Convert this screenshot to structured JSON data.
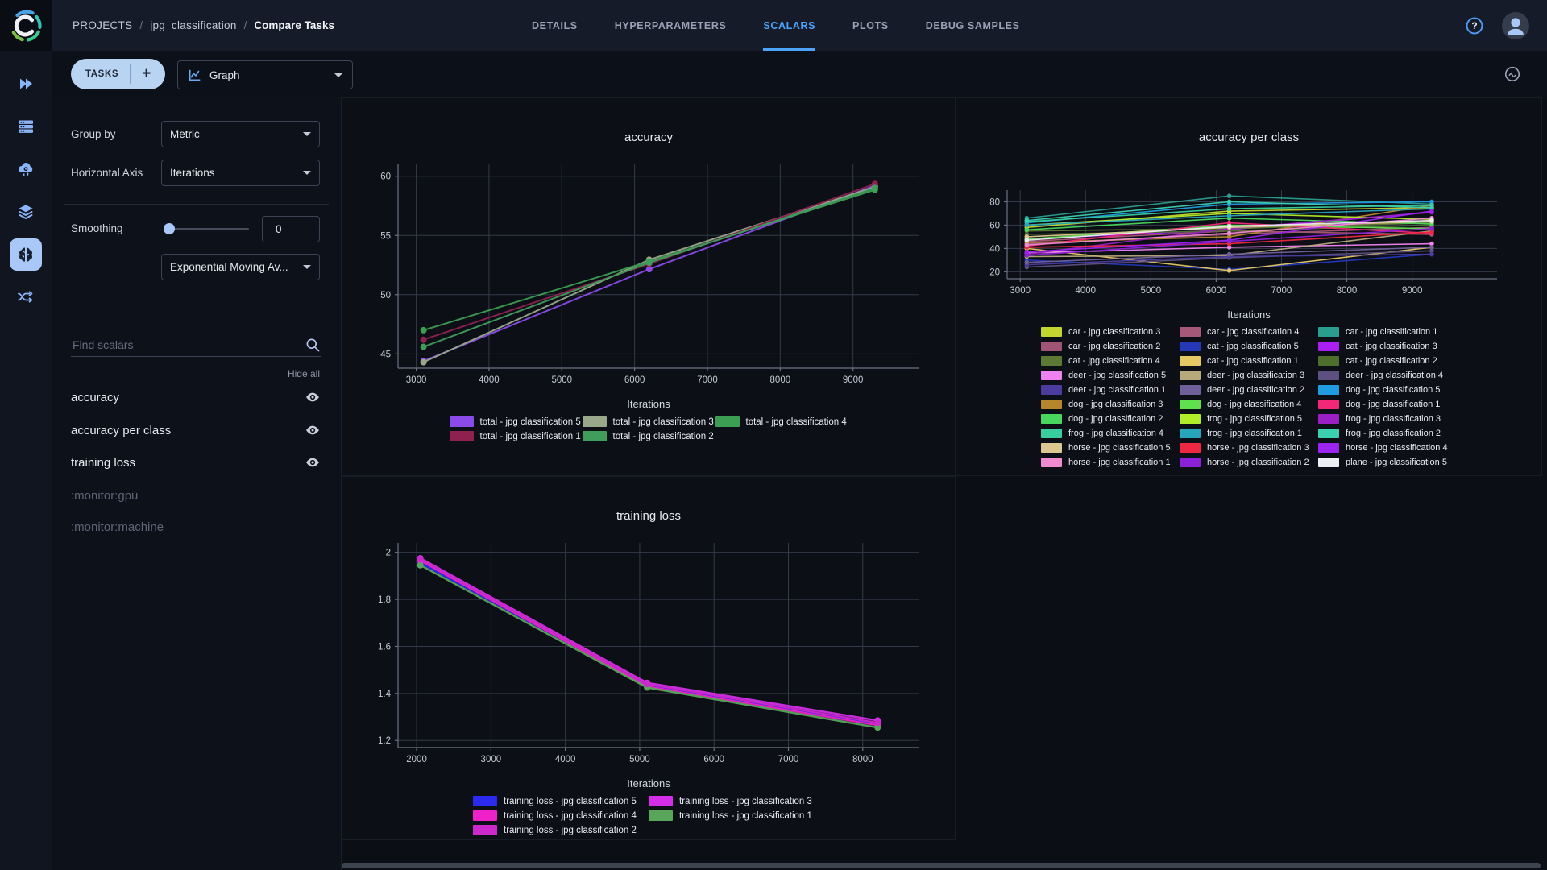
{
  "header": {
    "breadcrumb": {
      "root": "PROJECTS",
      "sep": "/",
      "project": "jpg_classification",
      "page": "Compare Tasks"
    },
    "tabs": [
      {
        "label": "DETAILS",
        "active": false
      },
      {
        "label": "HYPERPARAMETERS",
        "active": false
      },
      {
        "label": "SCALARS",
        "active": true
      },
      {
        "label": "PLOTS",
        "active": false
      },
      {
        "label": "DEBUG SAMPLES",
        "active": false
      }
    ]
  },
  "toolbar": {
    "tasks_button": "TASKS",
    "add_button": "+",
    "view_mode": "Graph"
  },
  "controls": {
    "group_by_label": "Group by",
    "group_by_value": "Metric",
    "horizontal_axis_label": "Horizontal Axis",
    "horizontal_axis_value": "Iterations",
    "smoothing_label": "Smoothing",
    "smoothing_value": "0",
    "smoothing_algorithm": "Exponential Moving Av...",
    "find_scalars_placeholder": "Find scalars",
    "hide_all_label": "Hide all",
    "metrics": [
      {
        "label": "accuracy",
        "visible": true
      },
      {
        "label": "accuracy per class",
        "visible": true
      },
      {
        "label": "training loss",
        "visible": true
      },
      {
        "label": ":monitor:gpu",
        "visible": false
      },
      {
        "label": ":monitor:machine",
        "visible": false
      }
    ]
  },
  "accent_colors": {
    "tab_active": "#4da3f8",
    "button_fill": "#b9d3f3",
    "nav_icon": "#8ab4f8"
  },
  "chart_data": [
    {
      "type": "line",
      "title": "accuracy",
      "xlabel": "Iterations",
      "x": [
        3100,
        6200,
        9300
      ],
      "xticks": [
        3000,
        4000,
        5000,
        6000,
        7000,
        8000,
        9000
      ],
      "yticks": [
        45,
        50,
        55,
        60
      ],
      "xlim": [
        2750,
        9900
      ],
      "ylim": [
        43.8,
        61
      ],
      "grid": true,
      "legend_position": "bottom",
      "series": [
        {
          "name": "total - jpg classification 5",
          "color": "#8a4be8",
          "values": [
            44.4,
            52.15,
            59.2
          ]
        },
        {
          "name": "total - jpg classification 3",
          "color": "#99a889",
          "values": [
            44.3,
            52.95,
            59.1
          ]
        },
        {
          "name": "total - jpg classification 4",
          "color": "#3c9e52",
          "values": [
            47.0,
            52.8,
            58.85
          ]
        },
        {
          "name": "total - jpg classification 1",
          "color": "#8e2150",
          "values": [
            46.2,
            52.6,
            59.35
          ]
        },
        {
          "name": "total - jpg classification 2",
          "color": "#3f9e5c",
          "values": [
            45.6,
            52.7,
            59.0
          ]
        }
      ]
    },
    {
      "type": "line",
      "title": "accuracy per class",
      "xlabel": "Iterations",
      "x": [
        3100,
        6200,
        9300
      ],
      "xticks": [
        3000,
        4000,
        5000,
        6000,
        7000,
        8000,
        9000
      ],
      "yticks": [
        20,
        40,
        60,
        80
      ],
      "xlim": [
        2800,
        10300
      ],
      "ylim": [
        14,
        90
      ],
      "grid": true,
      "legend_position": "bottom",
      "series": [
        {
          "name": "car - jpg classification 3",
          "color": "#c3d62e",
          "values": [
            58,
            72,
            75
          ]
        },
        {
          "name": "car - jpg classification 4",
          "color": "#a65878",
          "values": [
            46,
            55,
            52
          ]
        },
        {
          "name": "car - jpg classification 1",
          "color": "#2a9d8f",
          "values": [
            66,
            85,
            78
          ]
        },
        {
          "name": "car - jpg classification 2",
          "color": "#a05577",
          "values": [
            44,
            52,
            58
          ]
        },
        {
          "name": "cat - jpg classification 5",
          "color": "#2438b8",
          "values": [
            30,
            22,
            35
          ]
        },
        {
          "name": "cat - jpg classification 3",
          "color": "#aa1ff2",
          "values": [
            48,
            56,
            71
          ]
        },
        {
          "name": "cat - jpg classification 4",
          "color": "#5c7a33",
          "values": [
            55,
            57,
            62
          ]
        },
        {
          "name": "cat - jpg classification 1",
          "color": "#e5c763",
          "values": [
            40,
            21,
            41
          ]
        },
        {
          "name": "cat - jpg classification 2",
          "color": "#4d6e2d",
          "values": [
            52,
            55,
            60
          ]
        },
        {
          "name": "deer - jpg classification 5",
          "color": "#ee82ee",
          "values": [
            36,
            41,
            44
          ]
        },
        {
          "name": "deer - jpg classification 3",
          "color": "#b7a97b",
          "values": [
            33,
            34,
            55
          ]
        },
        {
          "name": "deer - jpg classification 4",
          "color": "#5e5080",
          "values": [
            24,
            32,
            38
          ]
        },
        {
          "name": "deer - jpg classification 1",
          "color": "#4b3c9e",
          "values": [
            26,
            33,
            35
          ]
        },
        {
          "name": "deer - jpg classification 2",
          "color": "#70609a",
          "values": [
            28,
            35,
            41
          ]
        },
        {
          "name": "dog - jpg classification 5",
          "color": "#1f9de0",
          "values": [
            62,
            78,
            80
          ]
        },
        {
          "name": "dog - jpg classification 3",
          "color": "#b5862b",
          "values": [
            45,
            50,
            77
          ]
        },
        {
          "name": "dog - jpg classification 4",
          "color": "#5fe04d",
          "values": [
            48,
            60,
            57
          ]
        },
        {
          "name": "dog - jpg classification 1",
          "color": "#f22778",
          "values": [
            42,
            62,
            53
          ]
        },
        {
          "name": "dog - jpg classification 2",
          "color": "#49d65c",
          "values": [
            56,
            66,
            61
          ]
        },
        {
          "name": "frog - jpg classification 5",
          "color": "#b2ec28",
          "values": [
            60,
            70,
            65
          ]
        },
        {
          "name": "frog - jpg classification 3",
          "color": "#9a1fc4",
          "values": [
            35,
            57,
            71
          ]
        },
        {
          "name": "frog - jpg classification 4",
          "color": "#36cf9d",
          "values": [
            63,
            74,
            77
          ]
        },
        {
          "name": "frog - jpg classification 1",
          "color": "#27a6bb",
          "values": [
            60,
            68,
            74
          ]
        },
        {
          "name": "frog - jpg classification 2",
          "color": "#3bd0b0",
          "values": [
            64,
            80,
            75
          ]
        },
        {
          "name": "horse - jpg classification 5",
          "color": "#dbc78f",
          "values": [
            50,
            58,
            63
          ]
        },
        {
          "name": "horse - jpg classification 3",
          "color": "#f02740",
          "values": [
            41,
            44,
            54
          ]
        },
        {
          "name": "horse - jpg classification 4",
          "color": "#9b24f0",
          "values": [
            37,
            47,
            72
          ]
        },
        {
          "name": "horse - jpg classification 1",
          "color": "#ee8ad0",
          "values": [
            43,
            53,
            66
          ]
        },
        {
          "name": "horse - jpg classification 2",
          "color": "#8a20d8",
          "values": [
            34,
            46,
            57
          ]
        },
        {
          "name": "plane - jpg classification 5",
          "color": "#eceef2",
          "values": [
            47,
            59,
            64
          ]
        }
      ]
    },
    {
      "type": "line",
      "title": "training loss",
      "xlabel": "Iterations",
      "x": [
        2050,
        5100,
        8200
      ],
      "xticks": [
        2000,
        3000,
        4000,
        5000,
        6000,
        7000,
        8000
      ],
      "yticks": [
        1.2,
        1.4,
        1.6,
        1.8,
        2
      ],
      "xlim": [
        1750,
        8750
      ],
      "ylim": [
        1.17,
        2.04
      ],
      "grid": true,
      "legend_position": "bottom",
      "series": [
        {
          "name": "training loss - jpg classification 5",
          "color": "#2b2bf0",
          "values": [
            1.955,
            1.435,
            1.27
          ]
        },
        {
          "name": "training loss - jpg classification 3",
          "color": "#d42ee8",
          "values": [
            1.975,
            1.445,
            1.285
          ]
        },
        {
          "name": "training loss - jpg classification 4",
          "color": "#ee22c8",
          "values": [
            1.965,
            1.43,
            1.265
          ]
        },
        {
          "name": "training loss - jpg classification 1",
          "color": "#57a65a",
          "values": [
            1.945,
            1.425,
            1.255
          ]
        },
        {
          "name": "training loss - jpg classification 2",
          "color": "#cc29cc",
          "values": [
            1.97,
            1.44,
            1.275
          ]
        }
      ]
    }
  ]
}
